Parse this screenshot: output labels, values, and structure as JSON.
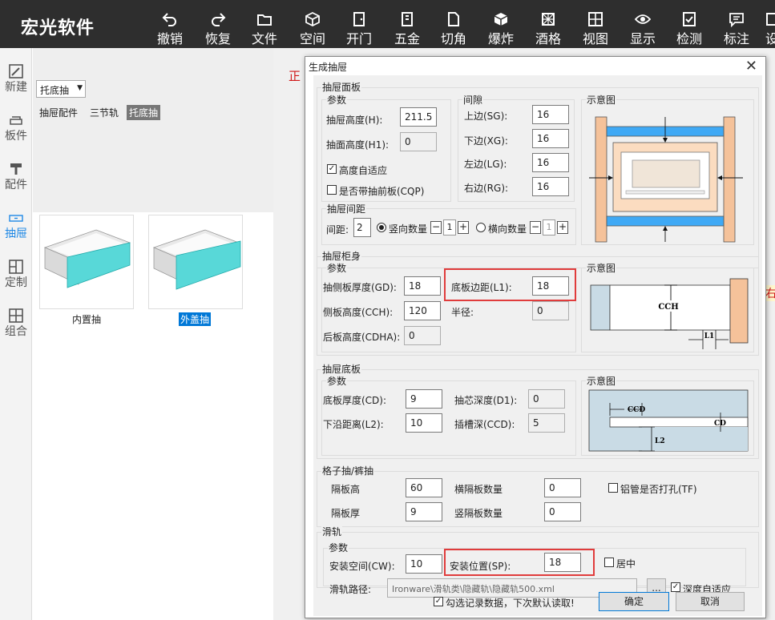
{
  "app": {
    "logo": "宏光软件",
    "toolbar": [
      "撤销",
      "恢复",
      "文件",
      "空间",
      "开门",
      "五金",
      "切角",
      "爆炸",
      "酒格",
      "视图",
      "显示",
      "检测",
      "标注"
    ],
    "toolbar_partial": "设"
  },
  "sidebar": [
    "新建",
    "板件",
    "配件",
    "抽屉",
    "定制",
    "组合"
  ],
  "left_panel": {
    "dropdown_value": "托底抽",
    "subtabs": [
      "抽屉配件",
      "三节轨",
      "托底抽"
    ],
    "cards": [
      "内置抽",
      "外盖抽"
    ]
  },
  "background_text": {
    "red_left": "正",
    "red_right": "右"
  },
  "dialog": {
    "title": "生成抽屉",
    "panel": {
      "group": "抽屉面板",
      "params_label": "参数",
      "height_label": "抽屉高度(H):",
      "height_value": "211.5",
      "face_height_label": "抽面高度(H1):",
      "face_height_value": "0",
      "auto_height_label": "高度自适应",
      "auto_height_checked": true,
      "front_panel_label": "是否带抽前板(CQP)",
      "front_panel_checked": false,
      "gap_label": "间隙",
      "sg_label": "上边(SG):",
      "sg_value": "16",
      "xg_label": "下边(XG):",
      "xg_value": "16",
      "lg_label": "左边(LG):",
      "lg_value": "16",
      "rg_label": "右边(RG):",
      "rg_value": "16",
      "diagram_label": "示意图"
    },
    "spacing": {
      "group": "抽屉间距",
      "label": "间距:",
      "value": "2",
      "vertical_label": "竖向数量",
      "vertical_value": "1",
      "vertical_selected": true,
      "horizontal_label": "横向数量",
      "horizontal_value": "1"
    },
    "body": {
      "group": "抽屉柜身",
      "params_label": "参数",
      "gd_label": "抽侧板厚度(GD):",
      "gd_value": "18",
      "l1_label": "底板边距(L1):",
      "l1_value": "18",
      "cch_label": "侧板高度(CCH):",
      "cch_value": "120",
      "radius_label": "半径:",
      "radius_value": "0",
      "cdha_label": "后板高度(CDHA):",
      "cdha_value": "0",
      "diagram_label": "示意图",
      "diagram_cch": "CCH",
      "diagram_l1": "L1"
    },
    "bottom": {
      "group": "抽屉底板",
      "params_label": "参数",
      "cd_label": "底板厚度(CD):",
      "cd_value": "9",
      "d1_label": "抽芯深度(D1):",
      "d1_value": "0",
      "l2_label": "下沿距离(L2):",
      "l2_value": "10",
      "ccd_label": "插槽深(CCD):",
      "ccd_value": "5",
      "diagram_label": "示意图",
      "diagram_ccd": "CCD",
      "diagram_cd": "CD",
      "diagram_l2": "L2"
    },
    "grid": {
      "group": "格子抽/裤抽",
      "div_height_label": "隔板高",
      "div_height_value": "60",
      "div_thick_label": "隔板厚",
      "div_thick_value": "9",
      "h_count_label": "横隔板数量",
      "h_count_value": "0",
      "v_count_label": "竖隔板数量",
      "v_count_value": "0",
      "drill_label": "铝管是否打孔(TF)",
      "drill_checked": false
    },
    "slide": {
      "group": "滑轨",
      "params_label": "参数",
      "cw_label": "安装空间(CW):",
      "cw_value": "10",
      "sp_label": "安装位置(SP):",
      "sp_value": "18",
      "center_label": "居中",
      "center_checked": false,
      "path_label": "滑轨路径:",
      "path_value": "Ironware\\滑轨类\\隐藏轨\\隐藏轨500.xml",
      "browse_label": "...",
      "depth_auto_label": "深度自适应",
      "depth_auto_checked": true
    },
    "footer": {
      "remember_label": "勾选记录数据，下次默认读取!",
      "remember_checked": true,
      "ok_label": "确定",
      "cancel_label": "取消"
    },
    "colors": {
      "highlight": "#e03c3c",
      "rail_blue": "#3fa9f5",
      "wood": "#f5c29a",
      "drawer_face": "#58d8d8"
    }
  }
}
